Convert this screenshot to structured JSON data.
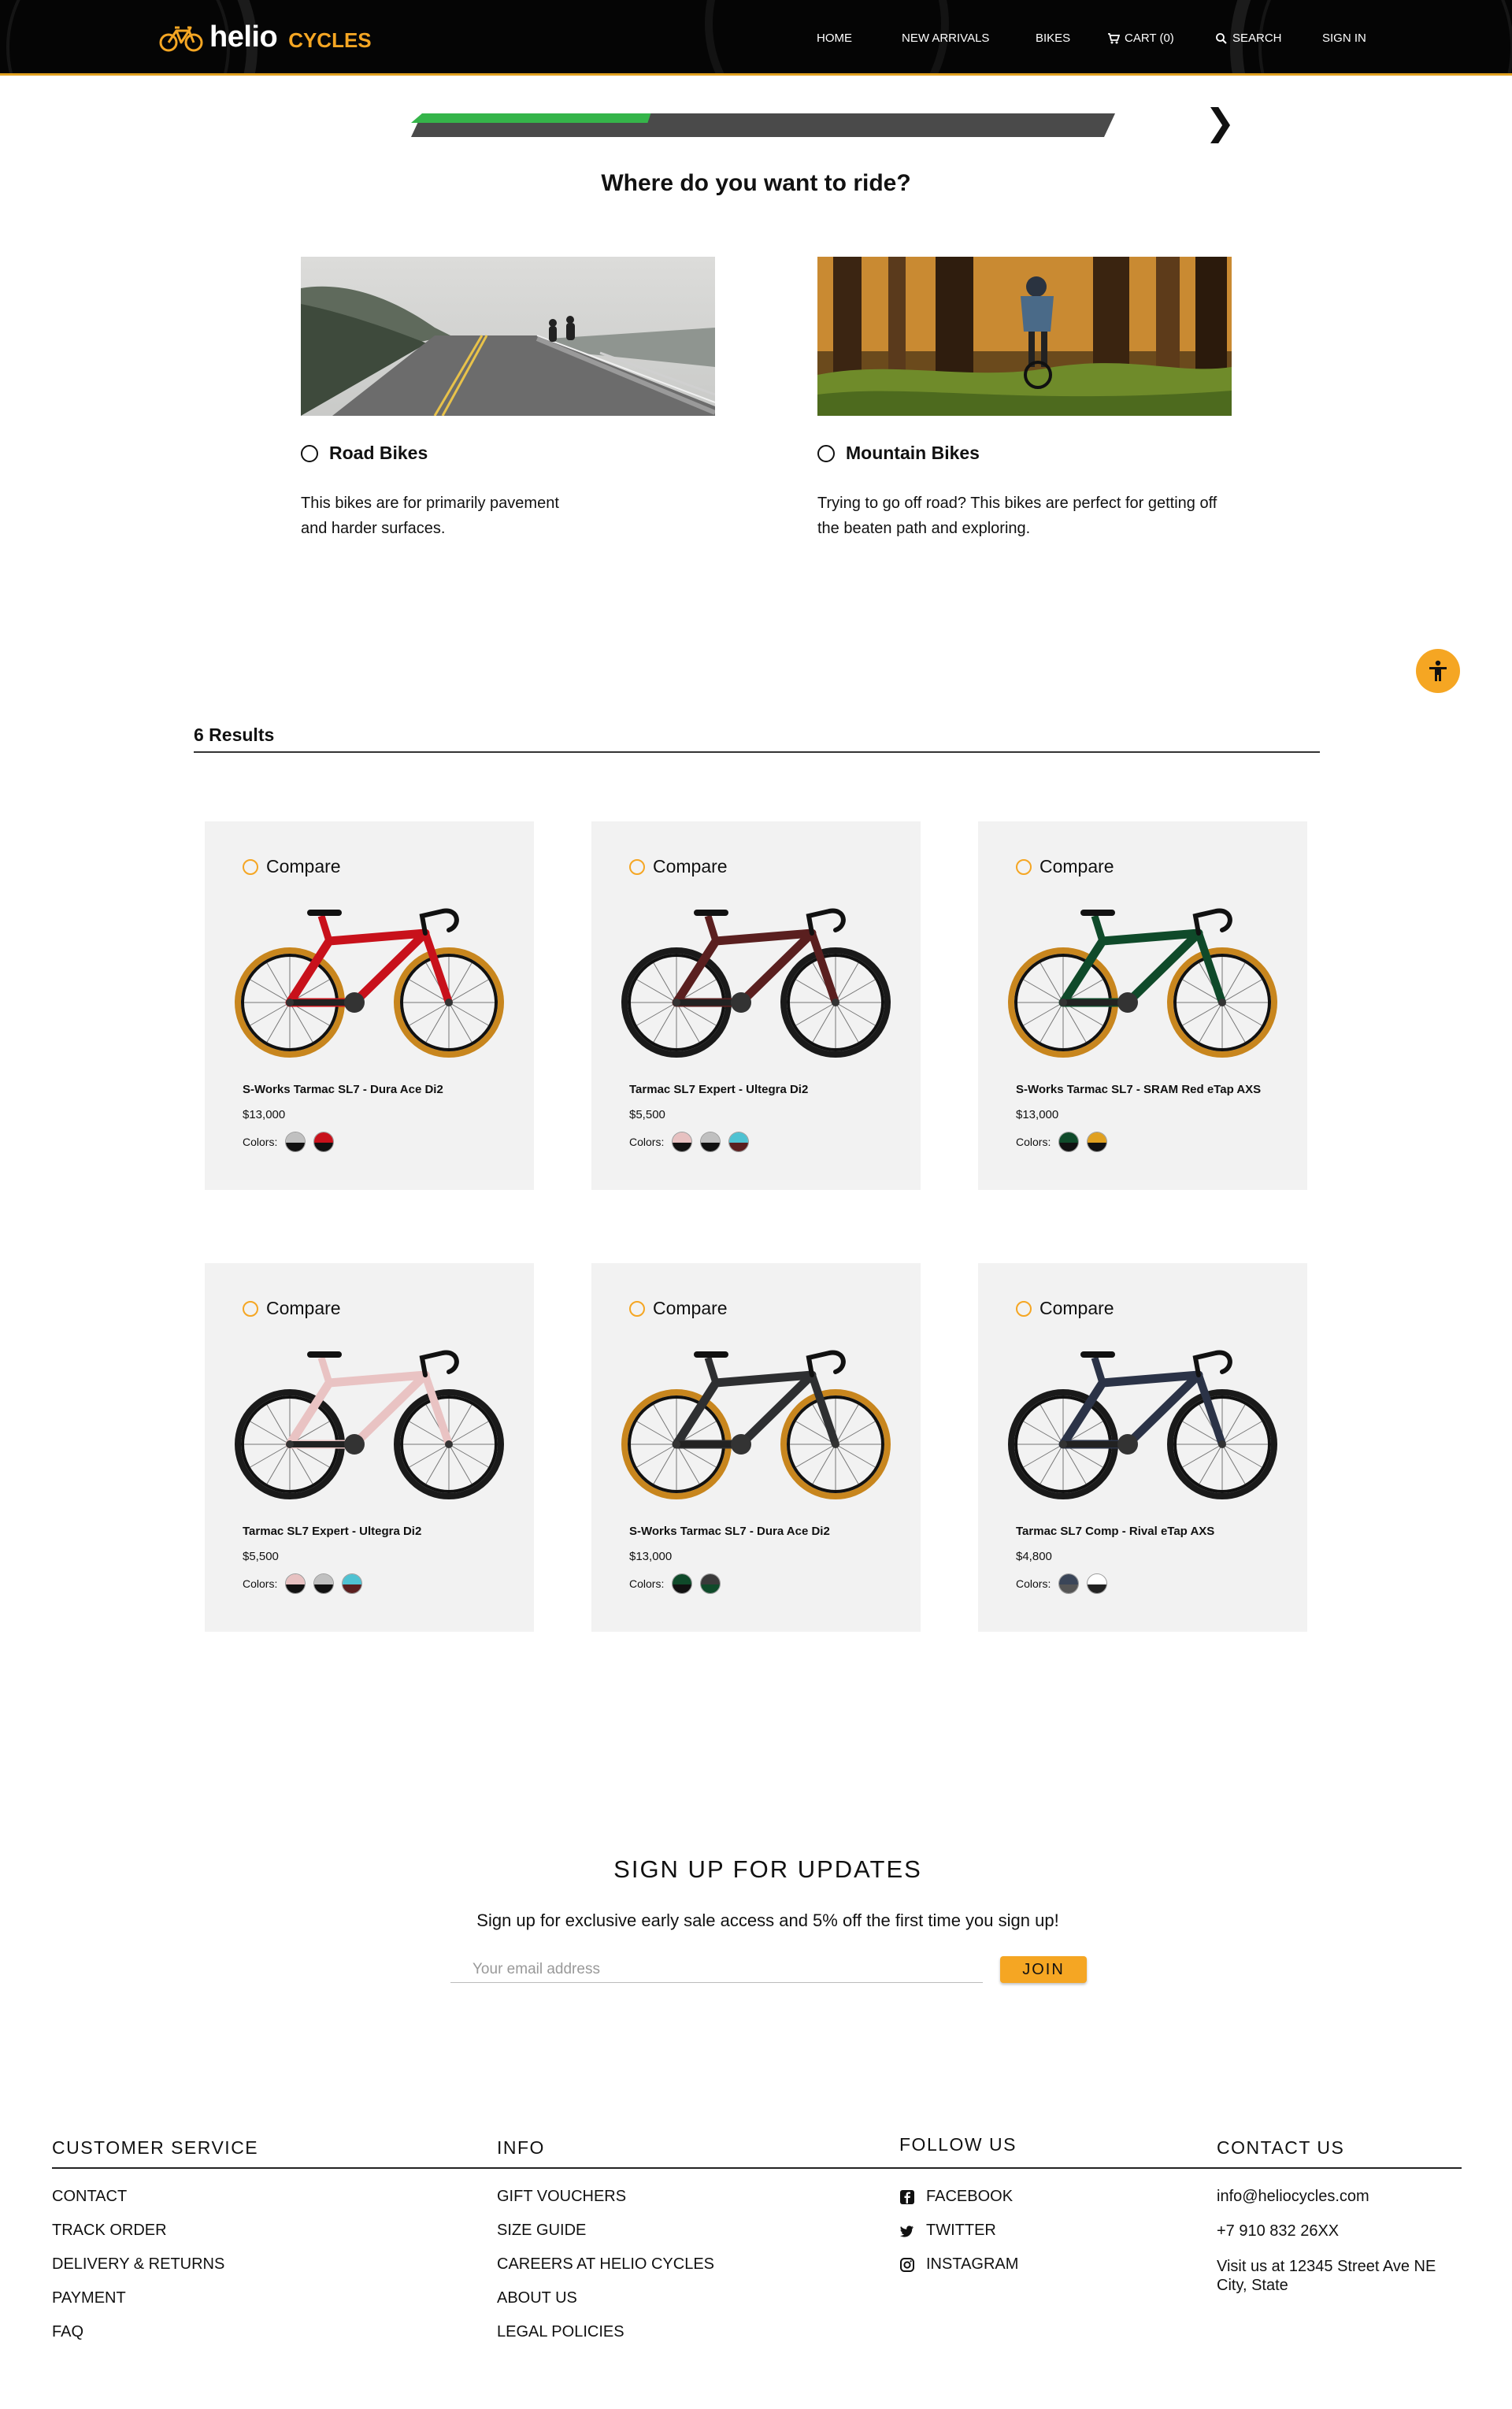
{
  "header": {
    "logo_name": "helio",
    "logo_sub": "CYCLES",
    "nav": [
      "HOME",
      "NEW ARRIVALS",
      "BIKES",
      "CART (0)",
      "SEARCH",
      "SIGN IN"
    ]
  },
  "wizard": {
    "progress": 0.33,
    "next_icon": "❯",
    "question": "Where do you want to ride?",
    "options": [
      {
        "label": "Road Bikes",
        "description": "This bikes are for primarily pavement and harder surfaces."
      },
      {
        "label": "Mountain Bikes",
        "description": "Trying to go off road? This bikes are perfect for getting off the beaten path and exploring."
      }
    ]
  },
  "results": {
    "count_label": "6 Results"
  },
  "products": [
    {
      "compare": "Compare",
      "name": "S-Works Tarmac SL7 - Dura Ace Di2",
      "price": "$13,000",
      "colors_label": "Colors:",
      "frame_color": "#c8111b",
      "swatches": [
        [
          "#c0c0c0",
          "#111111"
        ],
        [
          "#c8111b",
          "#111111"
        ]
      ]
    },
    {
      "compare": "Compare",
      "name": "Tarmac SL7 Expert - Ultegra Di2",
      "price": "$5,500",
      "colors_label": "Colors:",
      "frame_color": "#5a1f1f",
      "swatches": [
        [
          "#e7c1c1",
          "#111111"
        ],
        [
          "#c0c0c0",
          "#111111"
        ],
        [
          "#4fc2d2",
          "#5a1f1f"
        ]
      ]
    },
    {
      "compare": "Compare",
      "name": "S-Works Tarmac SL7 - SRAM Red eTap AXS",
      "price": "$13,000",
      "colors_label": "Colors:",
      "frame_color": "#0f4a2a",
      "swatches": [
        [
          "#0f4a2a",
          "#111111"
        ],
        [
          "#e0a020",
          "#111111"
        ]
      ]
    },
    {
      "compare": "Compare",
      "name": "Tarmac SL7 Expert - Ultegra Di2",
      "price": "$5,500",
      "colors_label": "Colors:",
      "frame_color": "#e9c3c3",
      "swatches": [
        [
          "#e7c1c1",
          "#111111"
        ],
        [
          "#c0c0c0",
          "#111111"
        ],
        [
          "#4fc2d2",
          "#5a1f1f"
        ]
      ]
    },
    {
      "compare": "Compare",
      "name": "S-Works Tarmac SL7 - Dura Ace Di2",
      "price": "$13,000",
      "colors_label": "Colors:",
      "frame_color": "#2e2f31",
      "swatches": [
        [
          "#0f4a2a",
          "#111111"
        ],
        [
          "#3a3a3a",
          "#0f4a2a"
        ]
      ]
    },
    {
      "compare": "Compare",
      "name": "Tarmac SL7 Comp - Rival eTap AXS",
      "price": "$4,800",
      "colors_label": "Colors:",
      "frame_color": "#2b3347",
      "swatches": [
        [
          "#3a4558",
          "#555555"
        ],
        [
          "#ffffff",
          "#222222"
        ]
      ]
    }
  ],
  "signup": {
    "title": "SIGN UP FOR UPDATES",
    "text": "Sign up for exclusive early sale access and 5% off the first time you sign up!",
    "placeholder": "Your email address",
    "button": "JOIN"
  },
  "footer": {
    "customer_service": {
      "title": "CUSTOMER SERVICE",
      "items": [
        "CONTACT",
        "TRACK ORDER",
        "DELIVERY & RETURNS",
        "PAYMENT",
        "FAQ"
      ]
    },
    "info": {
      "title": "INFO",
      "items": [
        "GIFT VOUCHERS",
        "SIZE GUIDE",
        "CAREERS AT HELIO CYCLES",
        "ABOUT US",
        "LEGAL POLICIES"
      ]
    },
    "follow": {
      "title": "FOLLOW US",
      "items": [
        "FACEBOOK",
        "TWITTER",
        "INSTAGRAM"
      ],
      "icons": [
        "facebook-icon",
        "twitter-icon",
        "instagram-icon"
      ]
    },
    "contact": {
      "title": "CONTACT US",
      "items": [
        "info@heliocycles.com",
        "+7 910 832 26XX",
        "Visit us at 12345 Street Ave NE City, State"
      ]
    }
  },
  "colors": {
    "accent": "#f5a623",
    "progress_fill": "#35b54a",
    "progress_track": "#4a4a4a",
    "card_bg": "#f2f2f2"
  }
}
